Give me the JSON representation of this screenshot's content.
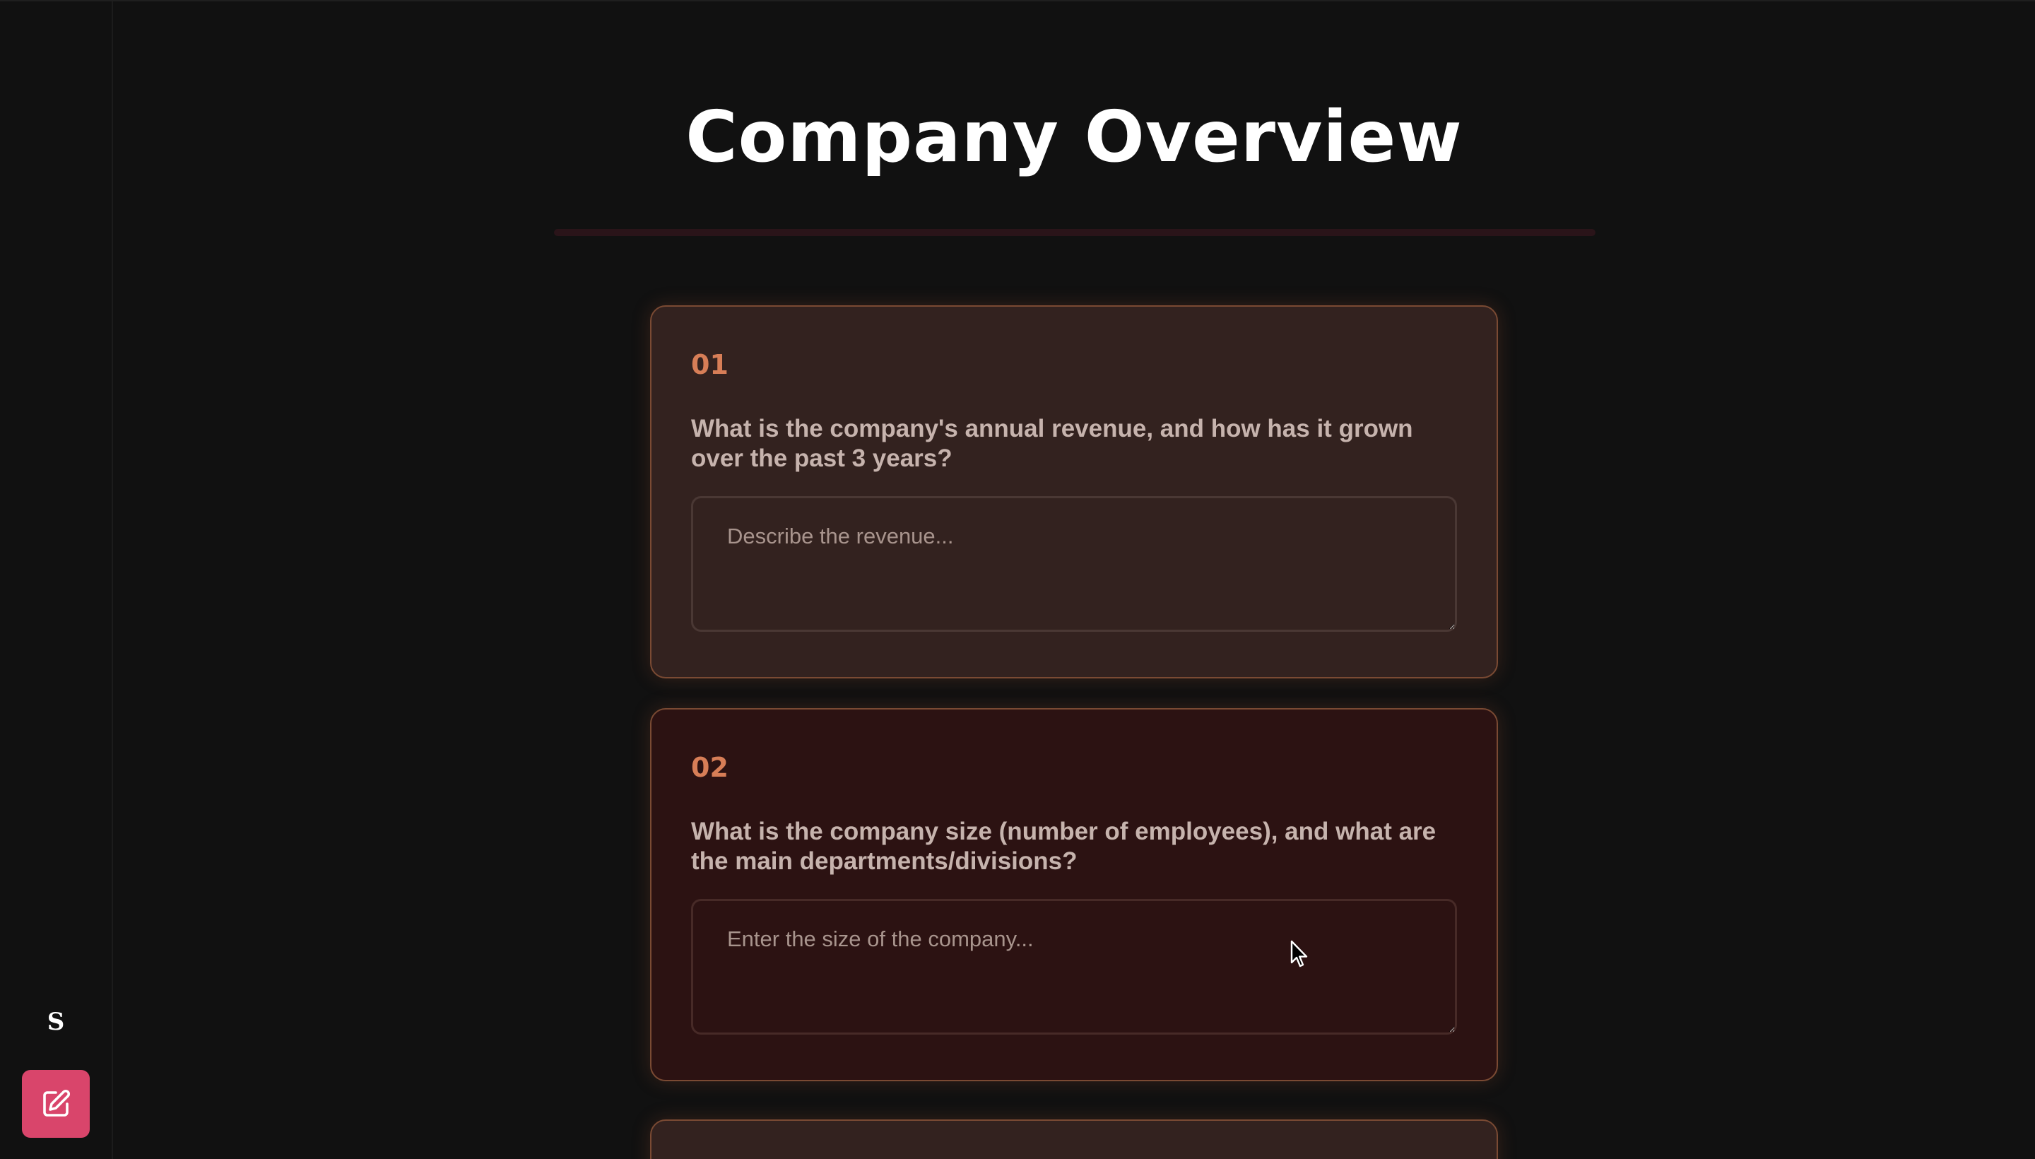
{
  "page": {
    "title": "Company Overview"
  },
  "sidebar": {
    "logo_text": "S",
    "compose_icon": "edit-icon"
  },
  "questions": [
    {
      "number": "01",
      "text": "What is the company's annual revenue, and how has it grown over the past 3 years?",
      "placeholder": "Describe the revenue...",
      "value": ""
    },
    {
      "number": "02",
      "text": "What is the company size (number of employees), and what are the main departments/divisions?",
      "placeholder": "Enter the size of the company...",
      "value": ""
    }
  ],
  "colors": {
    "background": "#111111",
    "accent": "#d9456b",
    "number": "#d77e57",
    "card_border": "#7a4a33"
  }
}
